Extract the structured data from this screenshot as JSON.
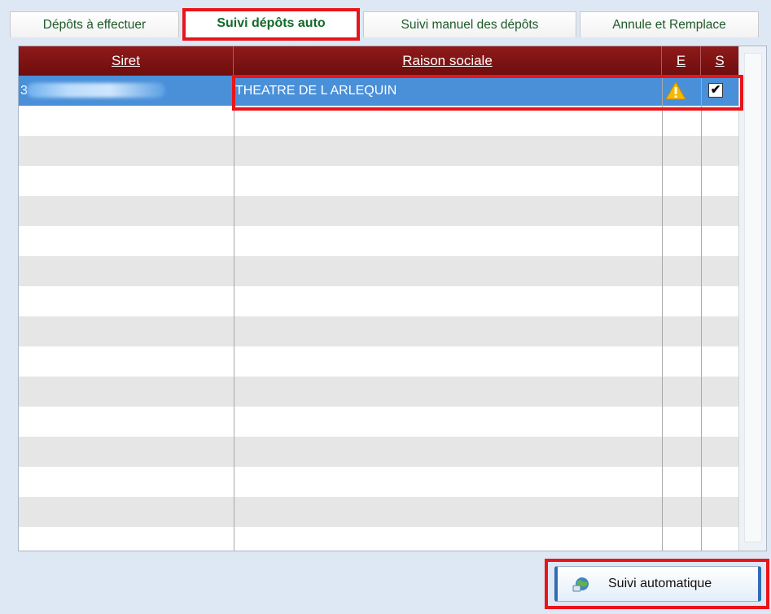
{
  "tabs": [
    {
      "label": "Dépôts à effectuer"
    },
    {
      "label": "Suivi dépôts auto"
    },
    {
      "label": "Suivi manuel des dépôts"
    },
    {
      "label": "Annule et Remplace"
    }
  ],
  "grid": {
    "columns": [
      "Siret",
      "Raison sociale",
      "E",
      "S"
    ],
    "rows": [
      {
        "siret": "3",
        "raison_sociale": "THEATRE DE L ARLEQUIN",
        "e_status": "warning-icon",
        "s_checked": true
      }
    ],
    "checkbox_mark": "✔"
  },
  "actions": {
    "suivi_label": "Suivi automatique"
  },
  "colors": {
    "header_bg": "#7a1010",
    "selected_row": "#4a90d9",
    "highlight_frame": "#e8151b",
    "tab_text": "#1d5a2a"
  }
}
